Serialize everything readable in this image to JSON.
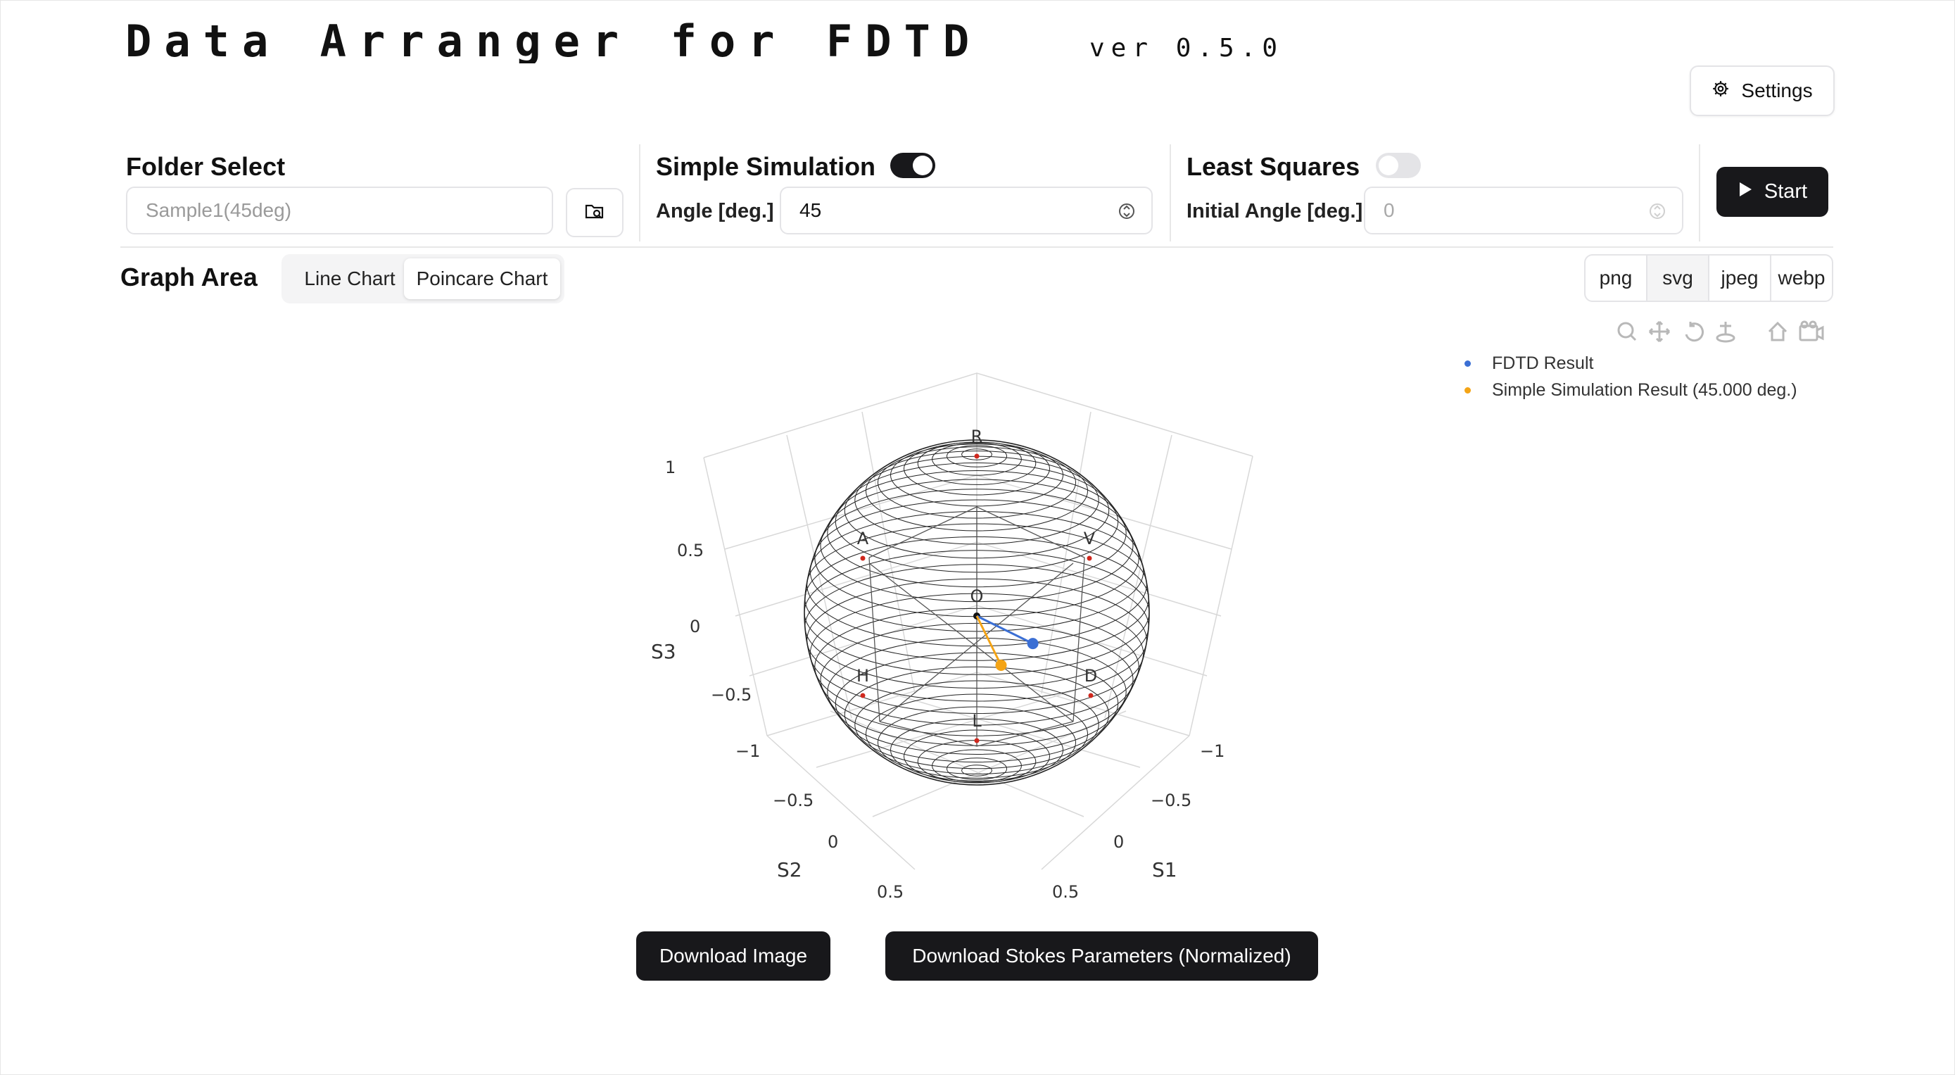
{
  "app": {
    "title": "Data Arranger for FDTD",
    "version": "ver 0.5.0"
  },
  "settings": {
    "label": "Settings",
    "icon": "gear-icon"
  },
  "folder_select": {
    "title": "Folder Select",
    "placeholder": "Sample1(45deg)",
    "browse_icon": "folder-search-icon"
  },
  "simple_simulation": {
    "title": "Simple Simulation",
    "enabled": true,
    "angle_label": "Angle [deg.]",
    "angle_value": "45"
  },
  "least_squares": {
    "title": "Least Squares",
    "enabled": false,
    "initial_angle_label": "Initial Angle [deg.]",
    "initial_angle_value": "0"
  },
  "start_button": {
    "label": "Start",
    "icon": "play-icon"
  },
  "graph": {
    "title": "Graph Area",
    "tabs": [
      {
        "label": "Line Chart",
        "active": false
      },
      {
        "label": "Poincare Chart",
        "active": true
      }
    ],
    "formats": [
      {
        "label": "png",
        "active": false
      },
      {
        "label": "svg",
        "active": true
      },
      {
        "label": "jpeg",
        "active": false
      },
      {
        "label": "webp",
        "active": false
      }
    ],
    "modebar_icons": [
      "zoom-icon",
      "pan-icon",
      "orbit-rotation-icon",
      "turntable-rotation-icon",
      "reset-camera-icon",
      "camera-snapshot-icon"
    ]
  },
  "chart_data": {
    "type": "scatter",
    "subtype": "poincare-sphere-3d",
    "axes": {
      "x": {
        "label": "S1",
        "range": [
          -1,
          1
        ],
        "ticks": [
          "−1",
          "−0.5",
          "0",
          "0.5"
        ]
      },
      "y": {
        "label": "S2",
        "range": [
          -1,
          1
        ],
        "ticks": [
          "−1",
          "−0.5",
          "0",
          "0.5"
        ]
      },
      "z": {
        "label": "S3",
        "range": [
          -1,
          1
        ],
        "ticks": [
          "−1",
          "−0.5",
          "0",
          "0.5",
          "1"
        ]
      }
    },
    "sphere_markers": [
      "R",
      "L",
      "H",
      "V",
      "D",
      "A",
      "O"
    ],
    "series": [
      {
        "name": "FDTD Result",
        "color": "#3b6fd4",
        "points": [
          [
            0,
            0,
            0
          ],
          [
            0.7,
            0.05,
            0
          ]
        ]
      },
      {
        "name": "Simple Simulation Result (45.000 deg.)",
        "color": "#f4a416",
        "points": [
          [
            0,
            0,
            0
          ],
          [
            0.42,
            0.55,
            0
          ]
        ]
      }
    ],
    "legend_position": "top-right",
    "grid": true
  },
  "downloads": {
    "image_label": "Download Image",
    "stokes_label": "Download Stokes Parameters (Normalized)"
  }
}
